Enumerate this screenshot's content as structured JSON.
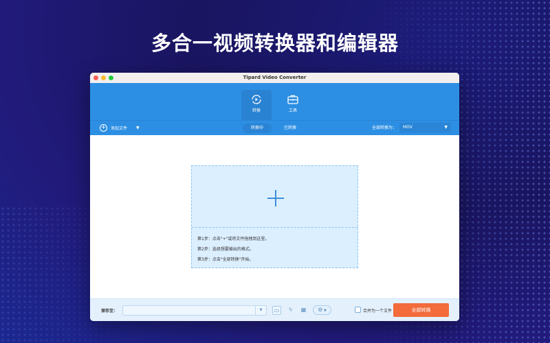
{
  "headline": "多合一视频转换器和编辑器",
  "window": {
    "title": "Tipard Video Converter"
  },
  "tabs": [
    {
      "label": "转换",
      "icon": "convert-icon"
    },
    {
      "label": "工具",
      "icon": "toolbox-icon"
    }
  ],
  "toolbar": {
    "add_file": "添加文件",
    "sub_tabs": [
      "转换中",
      "已转换"
    ],
    "convert_all_to_label": "全部转换为：",
    "format": "MOV"
  },
  "dropzone": {
    "steps": [
      "第1步：点击\"+\"或将文件拖拽到这里。",
      "第2步：选择想要输出的格式。",
      "第3步：点击\"全部转换\"开始。"
    ]
  },
  "bottom": {
    "save_to_label": "保存至：",
    "save_path": "",
    "merge_label": "合并为一个文件",
    "merge_checked": false,
    "convert_all_button": "全部转换",
    "accent": "#f36b3b"
  }
}
